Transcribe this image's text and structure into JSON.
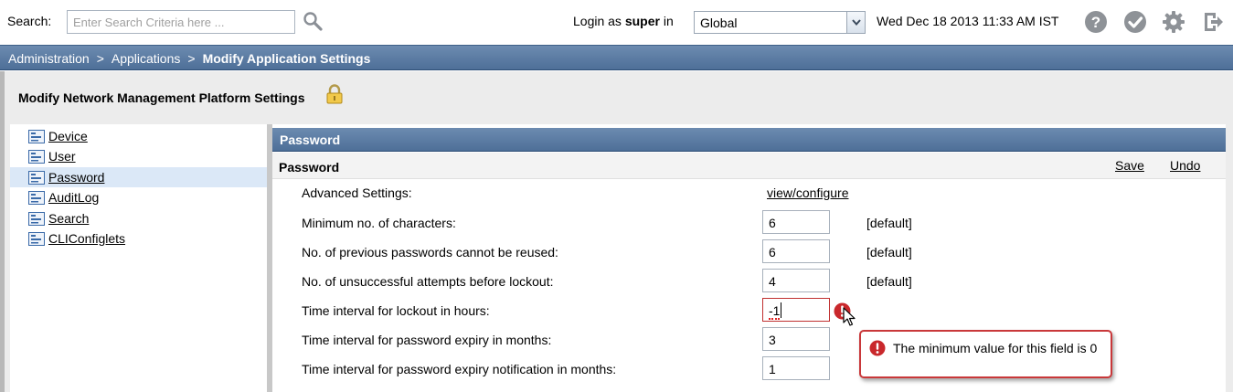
{
  "header": {
    "search_label": "Search:",
    "search_placeholder": "Enter Search Criteria here ...",
    "login_prefix": "Login as",
    "login_user": "super",
    "login_suffix": "in",
    "domain_selected": "Global",
    "datetime": "Wed Dec 18 2013 11:33 AM IST",
    "tools": [
      "help-icon",
      "check-icon",
      "gear-icon",
      "logout-icon"
    ]
  },
  "breadcrumb": {
    "items": [
      "Administration",
      "Applications",
      "Modify Application Settings"
    ],
    "separator": ">"
  },
  "page": {
    "title": "Modify Network Management Platform Settings"
  },
  "sidebar": {
    "items": [
      {
        "label": "Device",
        "selected": false
      },
      {
        "label": "User",
        "selected": false
      },
      {
        "label": "Password",
        "selected": true
      },
      {
        "label": "AuditLog",
        "selected": false
      },
      {
        "label": "Search",
        "selected": false
      },
      {
        "label": "CLIConfiglets",
        "selected": false
      }
    ]
  },
  "panel": {
    "header": "Password",
    "section_title": "Password",
    "save_label": "Save",
    "undo_label": "Undo",
    "advanced_label": "Advanced Settings:",
    "advanced_link": "view/configure",
    "default_text": "[default]",
    "fields": [
      {
        "label": "Minimum no. of characters:",
        "value": "6",
        "is_default": true
      },
      {
        "label": "No. of previous passwords cannot be reused:",
        "value": "6",
        "is_default": true
      },
      {
        "label": "No. of unsuccessful attempts before lockout:",
        "value": "4",
        "is_default": true
      },
      {
        "label": "Time interval for lockout in hours:",
        "value": "-1",
        "invalid": true
      },
      {
        "label": "Time interval for password expiry in months:",
        "value": "3"
      },
      {
        "label": "Time interval for password expiry notification in months:",
        "value": "1"
      }
    ]
  },
  "validation": {
    "message": "The minimum value for this field is 0"
  },
  "colors": {
    "header_blue": "#5a7aa3",
    "error_red": "#c9383a",
    "selected_bg": "#dbe8f7"
  }
}
